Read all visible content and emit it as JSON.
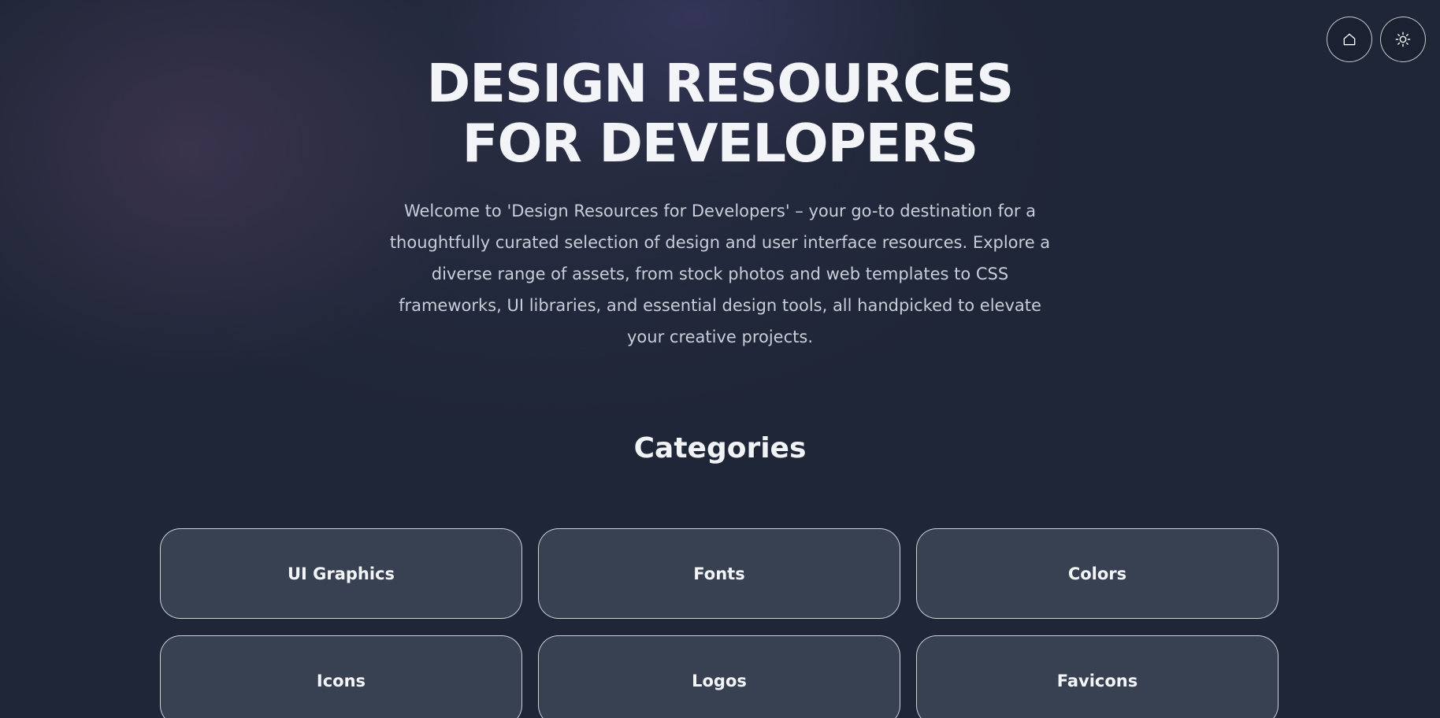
{
  "header": {
    "home_icon": "home-icon",
    "theme_icon": "sun-icon"
  },
  "hero": {
    "title_line1": "DESIGN RESOURCES",
    "title_line2": "FOR DEVELOPERS",
    "description": "Welcome to 'Design Resources for Developers' – your go-to destination for a thoughtfully curated selection of design and user interface resources. Explore a diverse range of assets, from stock photos and web templates to CSS frameworks, UI libraries, and essential design tools, all handpicked to elevate your creative projects."
  },
  "categories": {
    "title": "Categories",
    "items": [
      {
        "label": "UI Graphics"
      },
      {
        "label": "Fonts"
      },
      {
        "label": "Colors"
      },
      {
        "label": "Icons"
      },
      {
        "label": "Logos"
      },
      {
        "label": "Favicons"
      }
    ]
  },
  "colors": {
    "background": "#1f2637",
    "card": "#384152",
    "border": "#ffffff",
    "text": "#f3f4f8",
    "muted_text": "#c9cdd8"
  }
}
